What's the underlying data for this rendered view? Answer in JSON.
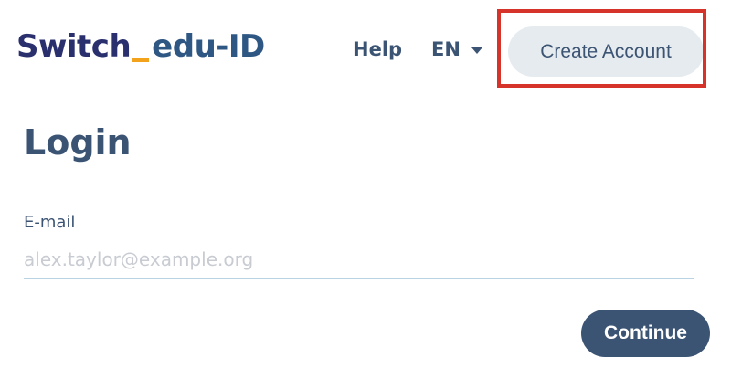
{
  "header": {
    "logo": {
      "part1": "Switch",
      "part2": "edu-ID"
    },
    "help_label": "Help",
    "language": "EN",
    "create_account_label": "Create Account"
  },
  "main": {
    "title": "Login",
    "email_label": "E-mail",
    "email_placeholder": "alex.taylor@example.org",
    "email_value": "",
    "continue_label": "Continue"
  },
  "colors": {
    "primary": "#3c5474",
    "logo_dark": "#2a2f6d",
    "logo_accent": "#f3a21b",
    "highlight": "#d6332b",
    "secondary_button_bg": "#e6ebef"
  }
}
